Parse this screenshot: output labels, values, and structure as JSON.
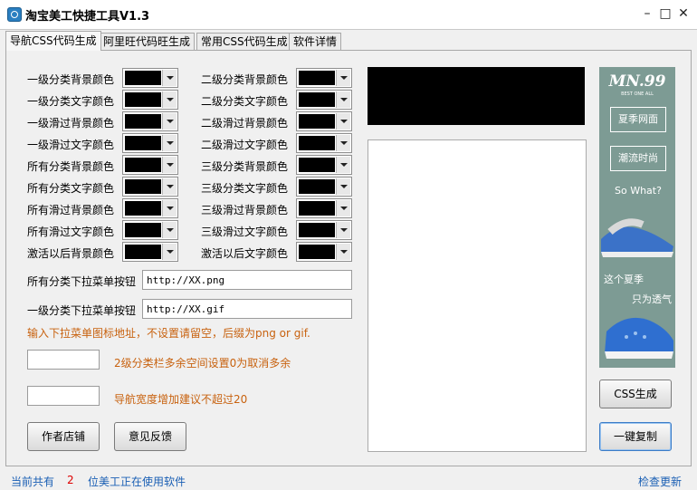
{
  "window": {
    "title": "淘宝美工快捷工具V1.3"
  },
  "tabs": [
    "导航CSS代码生成",
    "阿里旺代码旺生成",
    "常用CSS代码生成",
    "软件详情"
  ],
  "left_colors": [
    "一级分类背景颜色",
    "一级分类文字颜色",
    "一级滑过背景颜色",
    "一级滑过文字颜色",
    "所有分类背景颜色",
    "所有分类文字颜色",
    "所有滑过背景颜色",
    "所有滑过文字颜色",
    "激活以后背景颜色"
  ],
  "right_colors": [
    "二级分类背景颜色",
    "二级分类文字颜色",
    "二级滑过背景颜色",
    "二级滑过文字颜色",
    "三级分类背景颜色",
    "三级分类文字颜色",
    "三级滑过背景颜色",
    "三级滑过文字颜色",
    "激活以后文字颜色"
  ],
  "all_dropdown": {
    "label": "所有分类下拉菜单按钮",
    "value": "http://XX.png"
  },
  "first_dropdown": {
    "label": "一级分类下拉菜单按钮",
    "value": "http://XX.gif"
  },
  "icon_note": "输入下拉菜单图标地址，不设置请留空，后缀为png or gif.",
  "spacing_note": "2级分类栏多余空间设置0为取消多余",
  "width_note": "导航宽度增加建议不超过20",
  "buttons": {
    "author_shop": "作者店铺",
    "feedback": "意见反馈",
    "css_generate": "CSS生成",
    "copy_all": "一键复制"
  },
  "ad": {
    "brand": "MN.99",
    "sub": "BEST ONE ALL",
    "btn1": "夏季网面",
    "btn2": "潮流时尚",
    "line1": "So What?",
    "line2": "这个夏季",
    "line3": "只为透气"
  },
  "status": {
    "prefix": "当前共有",
    "count": "2",
    "suffix": "位美工正在使用软件",
    "update": "检查更新"
  },
  "colors": {
    "accent": "#1a5fb4",
    "note": "#c8620f",
    "swatch": "#000000"
  }
}
